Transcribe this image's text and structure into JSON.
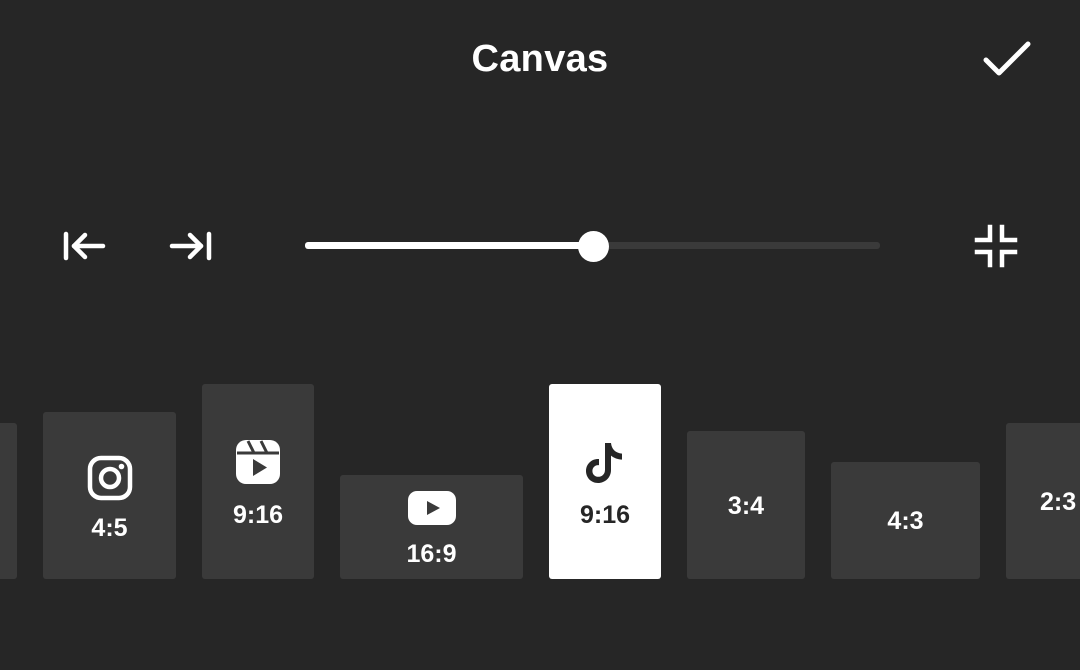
{
  "header": {
    "title": "Canvas",
    "confirm_icon": "checkmark-icon"
  },
  "controls": {
    "move_left_icon": "align-left-arrow-icon",
    "move_right_icon": "align-right-arrow-icon",
    "fit_icon": "collapse-corners-icon",
    "slider": {
      "value_fraction": 0.5
    }
  },
  "ratios": [
    {
      "label": "",
      "icon": null,
      "partial": true
    },
    {
      "label": "4:5",
      "icon": "instagram-icon"
    },
    {
      "label": "9:16",
      "icon": "instagram-reels-icon"
    },
    {
      "label": "16:9",
      "icon": "youtube-icon"
    },
    {
      "label": "9:16",
      "icon": "tiktok-icon",
      "selected": true
    },
    {
      "label": "3:4",
      "icon": null
    },
    {
      "label": "4:3",
      "icon": null
    },
    {
      "label": "2:3",
      "icon": null,
      "partial": true
    }
  ],
  "colors": {
    "background": "#262626",
    "card": "#3a3a3a",
    "selected_card": "#ffffff",
    "accent": "#ffffff"
  }
}
